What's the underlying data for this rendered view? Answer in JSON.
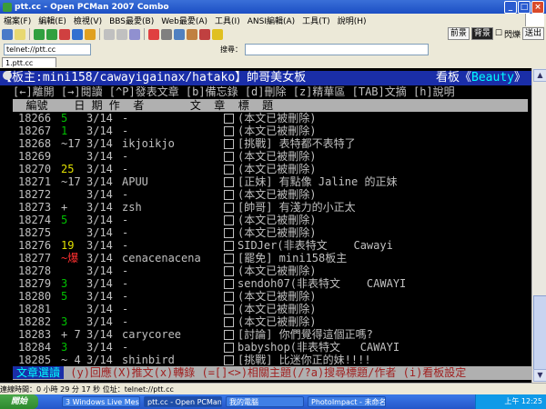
{
  "window": {
    "title": "ptt.cc - Open PCMan 2007 Combo"
  },
  "menu": [
    "檔案(F)",
    "編輯(E)",
    "檢視(V)",
    "BBS最愛(B)",
    "Web最愛(A)",
    "工具(I)",
    "ANSI編輯(A)",
    "工具(T)",
    "說明(H)"
  ],
  "toolbar": {
    "right": [
      "前景",
      "背景",
      "閃爍",
      "送出"
    ]
  },
  "address": {
    "value": "telnet://ptt.cc",
    "search_label": "搜尋："
  },
  "tab": {
    "label": "1.ptt.cc"
  },
  "term": {
    "header": "【板主:mini158/cawayigainax/hatako】帥哥美女板",
    "board_prefix": "看板《",
    "board_name": "Beauty",
    "board_suffix": "》",
    "help": "[←]離開 [→]閱讀 [^P]發表文章 [b]備忘錄 [d]刪除 [z]精華區 [TAB]文摘 [h]說明",
    "colhead": "  編號    日 期 作  者       文  章  標  題",
    "footer_mode": "文章選讀",
    "footer_keys": " (y)回應(X)推文(x)轉錄 (=[]<>)相關主題(/?a)搜尋標題/作者 (i)看板設定"
  },
  "posts": [
    {
      "no": "18266",
      "mark": "5",
      "date": "3/14",
      "author": "-",
      "title": "(本文已被刪除)"
    },
    {
      "no": "18267",
      "mark": "1",
      "date": "3/14",
      "author": "-",
      "title": "(本文已被刪除)"
    },
    {
      "no": "18268",
      "mark": "~17",
      "date": "3/14",
      "author": "ikjoikjo",
      "title": "[挑戰] 表特都不表特了"
    },
    {
      "no": "18269",
      "mark": "",
      "date": "3/14",
      "author": "-",
      "title": "(本文已被刪除)"
    },
    {
      "no": "18270",
      "mark": "25",
      "date": "3/14",
      "author": "-",
      "title": "(本文已被刪除)"
    },
    {
      "no": "18271",
      "mark": "~17",
      "date": "3/14",
      "author": "APUU",
      "title": "[正妹] 有點像 Jaline 的正妹"
    },
    {
      "no": "18272",
      "mark": "",
      "date": "3/14",
      "author": "-",
      "title": "(本文已被刪除)"
    },
    {
      "no": "18273",
      "mark": "+",
      "date": "3/14",
      "author": "zsh",
      "title": "[帥哥] 有淺力的小正太"
    },
    {
      "no": "18274",
      "mark": "5",
      "date": "3/14",
      "author": "-",
      "title": "(本文已被刪除)"
    },
    {
      "no": "18275",
      "mark": "",
      "date": "3/14",
      "author": "-",
      "title": "(本文已被刪除)"
    },
    {
      "no": "18276",
      "mark": "19",
      "date": "3/14",
      "author": "-",
      "title": "SIDJer(非表特文    Cawayi"
    },
    {
      "no": "18277",
      "mark": "~爆",
      "date": "3/14",
      "author": "cenacenacena",
      "title": "[罷免] mini158板主"
    },
    {
      "no": "18278",
      "mark": "",
      "date": "3/14",
      "author": "-",
      "title": "(本文已被刪除)"
    },
    {
      "no": "18279",
      "mark": "3",
      "date": "3/14",
      "author": "-",
      "title": "sendoh07(非表特文    CAWAYI"
    },
    {
      "no": "18280",
      "mark": "5",
      "date": "3/14",
      "author": "-",
      "title": "(本文已被刪除)"
    },
    {
      "no": "18281",
      "mark": "",
      "date": "3/14",
      "author": "-",
      "title": "(本文已被刪除)"
    },
    {
      "no": "18282",
      "mark": "3",
      "date": "3/14",
      "author": "-",
      "title": "(本文已被刪除)"
    },
    {
      "no": "18283",
      "mark": "+ 7",
      "date": "3/14",
      "author": "carycoree",
      "title": "[討論] 你們覺得這個正嗎?"
    },
    {
      "no": "18284",
      "mark": "3",
      "date": "3/14",
      "author": "-",
      "title": "babyshop(非表特文   CAWAYI"
    },
    {
      "no": "18285",
      "mark": "~ 4",
      "date": "3/14",
      "author": "shinbird",
      "title": "[挑戰] 比迷你正的妹!!!!"
    }
  ],
  "statusbar": {
    "text": "連線時間：0 小時 29 分 17 秒   位址：telnet://ptt.cc"
  },
  "taskbar": {
    "start": "開始",
    "items": [
      "3 Windows Live Mes...",
      "ptt.cc - Open PCMan 2...",
      "我的電腦",
      "PhotoImpact - 未命名..."
    ],
    "clock": "上午 12:25"
  }
}
